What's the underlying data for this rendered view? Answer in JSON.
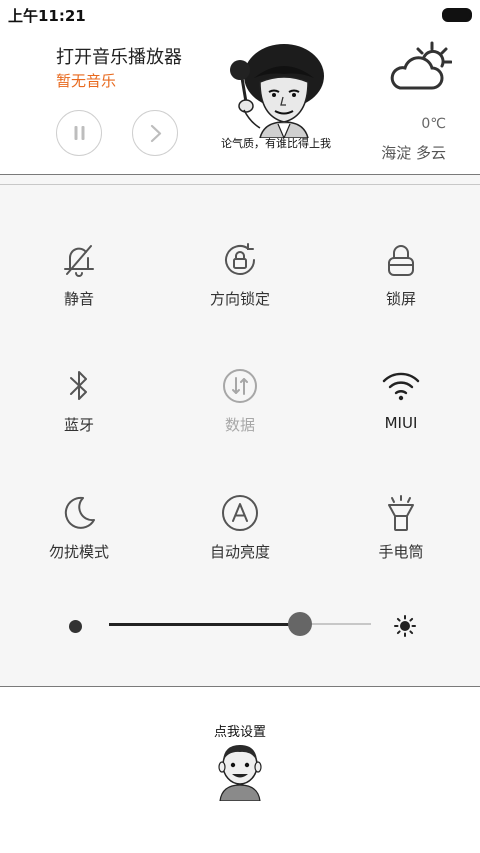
{
  "status_bar": {
    "time": "上午11:21",
    "battery_icon": "battery-full-icon"
  },
  "music": {
    "title": "打开音乐播放器",
    "status": "暂无音乐",
    "status_color": "#e86a1f",
    "pause_icon": "pause-icon",
    "next_icon": "chevron-right-icon"
  },
  "meme": {
    "caption": "论气质，有谁比得上我"
  },
  "weather": {
    "icon": "partly-cloudy-icon",
    "temperature": "0℃",
    "location": "海淀  多云"
  },
  "toggles": [
    {
      "label": "静音",
      "icon": "bell-off-icon",
      "active": true
    },
    {
      "label": "方向锁定",
      "icon": "rotation-lock-icon",
      "active": true
    },
    {
      "label": "锁屏",
      "icon": "lock-icon",
      "active": true
    },
    {
      "label": "蓝牙",
      "icon": "bluetooth-icon",
      "active": true
    },
    {
      "label": "数据",
      "icon": "mobile-data-icon",
      "active": false
    },
    {
      "label": "MIUI",
      "icon": "wifi-icon",
      "active": true
    },
    {
      "label": "勿扰模式",
      "icon": "moon-icon",
      "active": true
    },
    {
      "label": "自动亮度",
      "icon": "auto-brightness-icon",
      "active": true
    },
    {
      "label": "手电筒",
      "icon": "flashlight-icon",
      "active": true
    }
  ],
  "brightness": {
    "level": 0.73,
    "low_icon": "brightness-low-icon",
    "high_icon": "brightness-high-icon"
  },
  "footer": {
    "settings_label": "点我设置"
  },
  "colors": {
    "accent": "#e86a1f",
    "icon_active": "#555555",
    "icon_inactive": "#a7a7a7"
  }
}
